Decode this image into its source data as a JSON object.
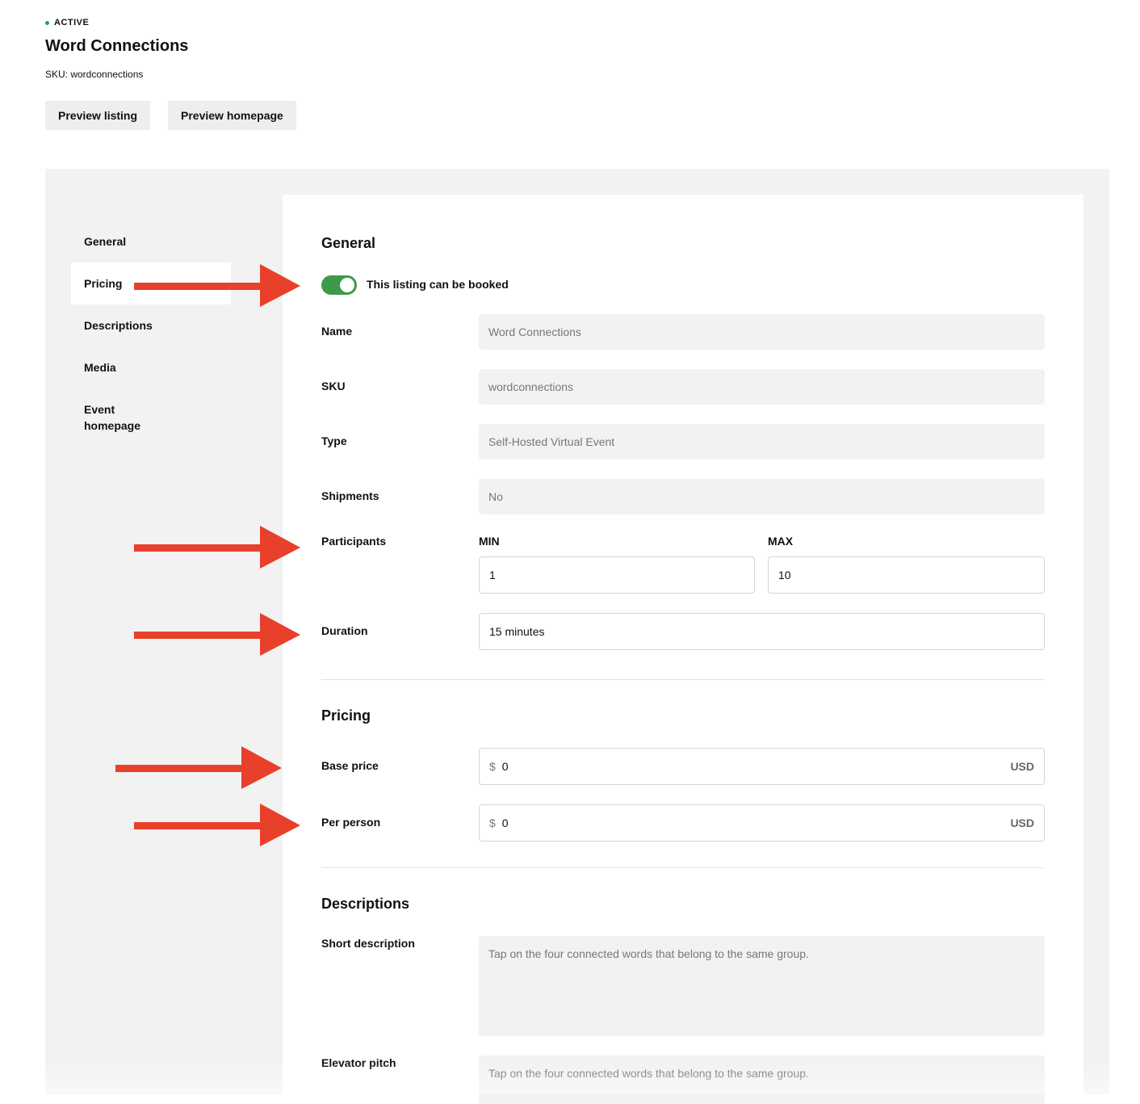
{
  "header": {
    "status": "ACTIVE",
    "title": "Word Connections",
    "sku_line": "SKU: wordconnections",
    "preview_listing": "Preview listing",
    "preview_homepage": "Preview homepage"
  },
  "sidebar": {
    "items": [
      {
        "label": "General"
      },
      {
        "label": "Pricing"
      },
      {
        "label": "Descriptions"
      },
      {
        "label": "Media"
      },
      {
        "label": "Event homepage"
      }
    ],
    "active": "Pricing"
  },
  "general": {
    "title": "General",
    "toggle_label": "This listing can be booked",
    "name_label": "Name",
    "name_value": "Word Connections",
    "sku_label": "SKU",
    "sku_value": "wordconnections",
    "type_label": "Type",
    "type_value": "Self-Hosted Virtual Event",
    "shipments_label": "Shipments",
    "shipments_value": "No",
    "participants_label": "Participants",
    "min_label": "MIN",
    "min_value": "1",
    "max_label": "MAX",
    "max_value": "10",
    "duration_label": "Duration",
    "duration_value": "15 minutes"
  },
  "pricing": {
    "title": "Pricing",
    "base_label": "Base price",
    "base_currency": "$",
    "base_value": "0",
    "base_unit": "USD",
    "per_person_label": "Per person",
    "per_person_currency": "$",
    "per_person_value": "0",
    "per_person_unit": "USD"
  },
  "descriptions": {
    "title": "Descriptions",
    "short_label": "Short description",
    "short_value": "Tap on the four connected words that belong to the same group.",
    "pitch_label": "Elevator pitch",
    "pitch_value": "Tap on the four connected words that belong to the same group."
  },
  "colors": {
    "accent_green": "#3d9a4a",
    "annotation_arrow": "#e8402a",
    "panel_bg": "#f2f2f3"
  }
}
